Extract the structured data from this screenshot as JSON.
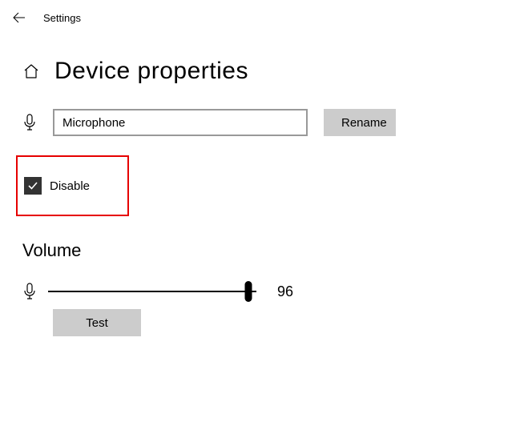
{
  "header": {
    "title": "Settings"
  },
  "page": {
    "title": "Device properties"
  },
  "device": {
    "name_value": "Microphone",
    "rename_label": "Rename"
  },
  "disable": {
    "label": "Disable",
    "checked": true
  },
  "volume": {
    "section_label": "Volume",
    "value": 96,
    "test_label": "Test"
  }
}
